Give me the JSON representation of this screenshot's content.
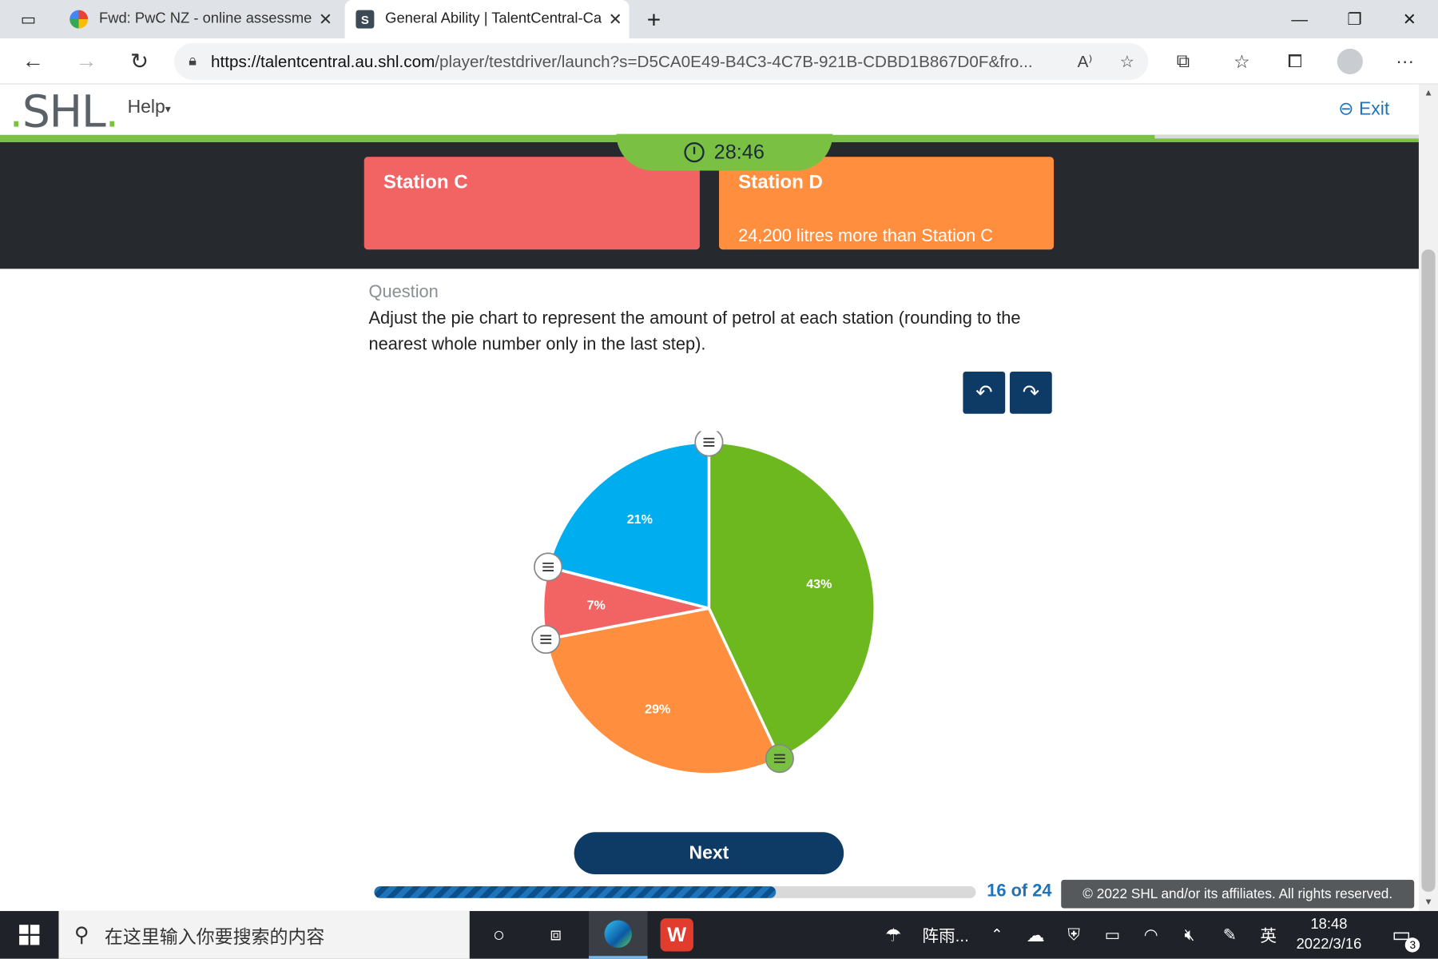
{
  "browser": {
    "tabs": [
      {
        "title": "Fwd: PwC NZ - online assessmen",
        "icon": "gmail-icon"
      },
      {
        "title": "General Ability | TalentCentral-Ca",
        "icon": "shl-favicon",
        "favicon_letter": "S"
      }
    ],
    "new_tab": "+",
    "url_domain": "https://talentcentral.au.shl.com",
    "url_rest": "/player/testdriver/launch?s=D5CA0E49-B4C3-4C7B-921B-CDBD1B867D0F&fro..."
  },
  "app": {
    "logo_main": "SHL",
    "help": "Help",
    "exit": "Exit",
    "timer": "28:46"
  },
  "cards": [
    {
      "name": "Station C",
      "desc": "",
      "color": "#f26464"
    },
    {
      "name": "Station D",
      "desc": "24,200 litres more than Station C",
      "color": "#ff8f3f"
    }
  ],
  "question": {
    "label": "Question",
    "text": "Adjust the pie chart to represent the amount of petrol at each station (rounding to the nearest whole number only in the last step)."
  },
  "chart_data": {
    "type": "pie",
    "slices": [
      {
        "label": "43%",
        "value": 43,
        "color": "#6cb81e"
      },
      {
        "label": "29%",
        "value": 29,
        "color": "#ff8f3f"
      },
      {
        "label": "7%",
        "value": 7,
        "color": "#f26464"
      },
      {
        "label": "21%",
        "value": 21,
        "color": "#00aeef"
      }
    ],
    "start_angle_deg": 0,
    "direction": "clockwise from top"
  },
  "buttons": {
    "next": "Next",
    "undo_icon": "undo-icon",
    "redo_icon": "redo-icon"
  },
  "footer": {
    "progress": "16 of 24",
    "progress_fraction": 0.667,
    "copyright": "© 2022 SHL and/or its affiliates. All rights reserved."
  },
  "taskbar": {
    "search_placeholder": "在这里输入你要搜索的内容",
    "weather": "阵雨...",
    "ime": "英",
    "time": "18:48",
    "date": "2022/3/16",
    "notif_count": "3"
  }
}
